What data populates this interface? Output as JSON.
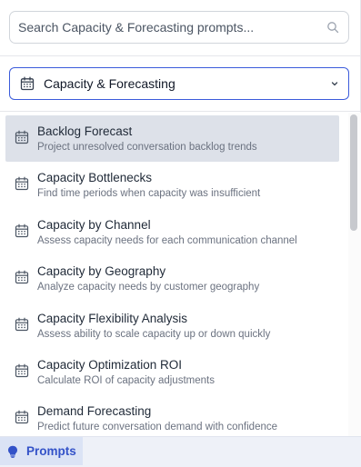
{
  "search": {
    "placeholder": "Search Capacity & Forecasting prompts..."
  },
  "category_select": {
    "selected": "Capacity & Forecasting"
  },
  "prompts": [
    {
      "title": "Backlog Forecast",
      "description": "Project unresolved conversation backlog trends",
      "active": true
    },
    {
      "title": "Capacity Bottlenecks",
      "description": "Find time periods when capacity was insufficient"
    },
    {
      "title": "Capacity by Channel",
      "description": "Assess capacity needs for each communication channel"
    },
    {
      "title": "Capacity by Geography",
      "description": "Analyze capacity needs by customer geography"
    },
    {
      "title": "Capacity Flexibility Analysis",
      "description": "Assess ability to scale capacity up or down quickly"
    },
    {
      "title": "Capacity Optimization ROI",
      "description": "Calculate ROI of capacity adjustments"
    },
    {
      "title": "Demand Forecasting",
      "description": "Predict future conversation demand with confidence"
    }
  ],
  "bottom_tab": {
    "label": "Prompts"
  },
  "colors": {
    "accent": "#3b5bdb",
    "active_row": "#dde1e9",
    "tab_bg": "#dbe3f5",
    "tab_text": "#3352c8"
  },
  "icons": {
    "search": "search-icon",
    "calendar": "calendar-icon",
    "chevron": "chevron-down-icon",
    "prompts": "lightbulb-icon"
  }
}
